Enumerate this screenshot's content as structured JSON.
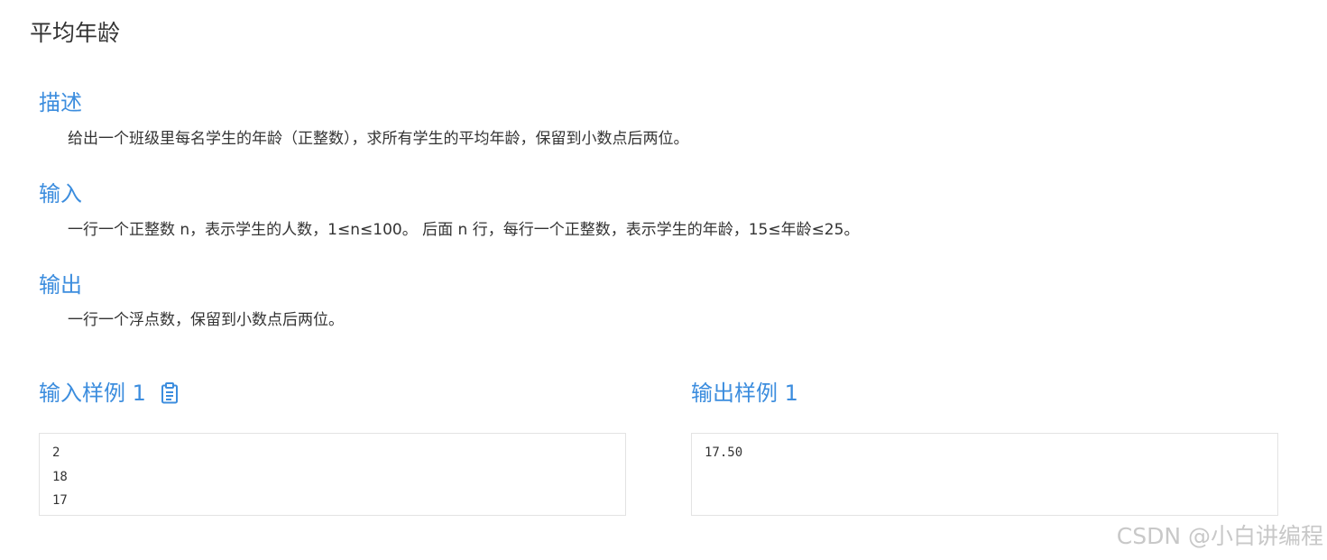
{
  "title": "平均年龄",
  "sections": {
    "description": {
      "heading": "描述",
      "text": "给出一个班级里每名学生的年龄（正整数），求所有学生的平均年龄，保留到小数点后两位。"
    },
    "input": {
      "heading": "输入",
      "text": "一行一个正整数 n，表示学生的人数，1≤n≤100。 后面 n 行，每行一个正整数，表示学生的年龄，15≤年龄≤25。"
    },
    "output": {
      "heading": "输出",
      "text": "一行一个浮点数，保留到小数点后两位。"
    }
  },
  "samples": {
    "input": {
      "heading": "输入样例 1",
      "icon": "clipboard-icon",
      "lines": [
        "2",
        "18",
        "17"
      ]
    },
    "output": {
      "heading": "输出样例 1",
      "lines": [
        "17.50"
      ]
    }
  },
  "watermark": "CSDN @小白讲编程",
  "colors": {
    "accent": "#3c8dde",
    "text": "#333333",
    "border": "#e3e3e3",
    "watermark": "#c8c8c8"
  }
}
